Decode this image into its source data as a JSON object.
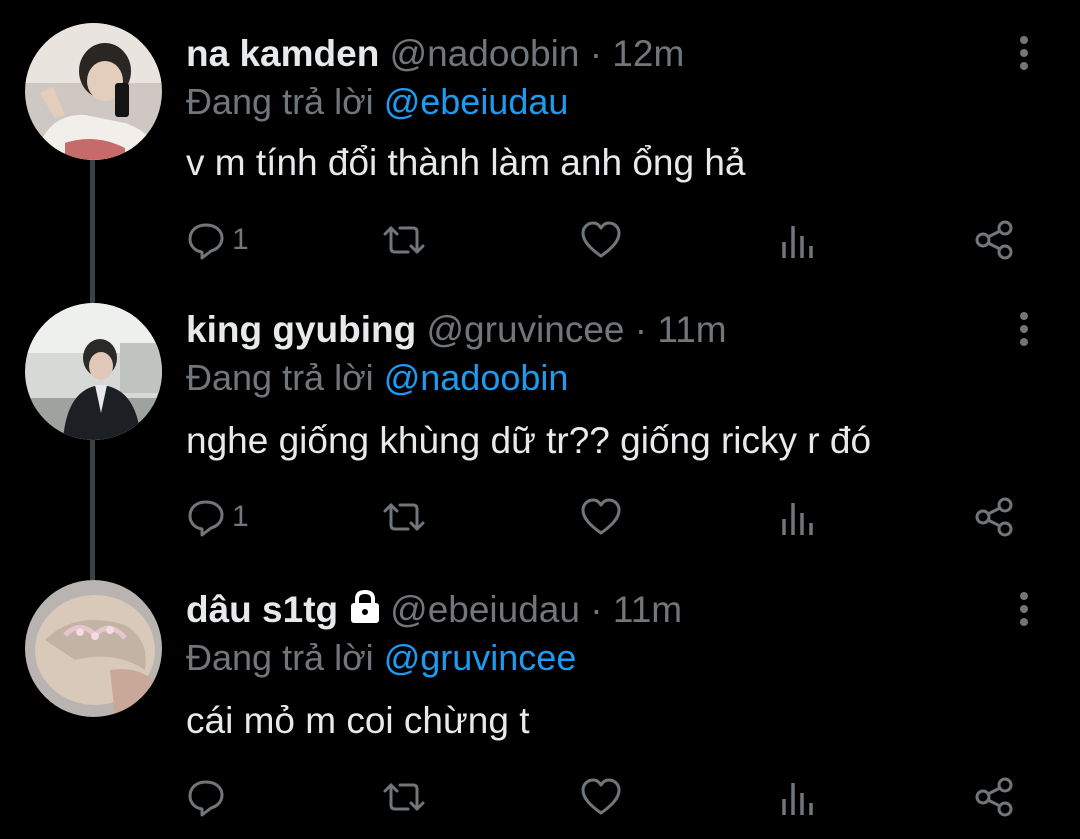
{
  "colors": {
    "background": "#000000",
    "text_primary": "#e7e9ea",
    "text_secondary": "#71767b",
    "accent": "#1d9bf0",
    "thread_line": "#3e4144"
  },
  "tweets": [
    {
      "display_name": "na kamden",
      "handle": "@nadoobin",
      "separator": "·",
      "time": "12m",
      "reply_prefix": "Đang trả lời",
      "reply_to": "@ebeiudau",
      "text": "v m tính đổi thành làm anh ổng hả",
      "reply_count": "1",
      "protected": false
    },
    {
      "display_name": "king gyubing",
      "handle": "@gruvincee",
      "separator": "·",
      "time": "11m",
      "reply_prefix": "Đang trả lời",
      "reply_to": "@nadoobin",
      "text": "nghe giống khùng dữ tr?? giống ricky r đó",
      "reply_count": "1",
      "protected": false
    },
    {
      "display_name": "dâu s1tg",
      "handle": "@ebeiudau",
      "separator": "·",
      "time": "11m",
      "reply_prefix": "Đang trả lời",
      "reply_to": "@gruvincee",
      "text": "cái mỏ m coi chừng t",
      "reply_count": "",
      "protected": true
    }
  ],
  "icons": {
    "reply": "reply-bubble-icon",
    "retweet": "retweet-icon",
    "like": "heart-icon",
    "views": "analytics-icon",
    "share": "share-icon",
    "more": "more-vertical-icon",
    "lock": "lock-icon"
  }
}
